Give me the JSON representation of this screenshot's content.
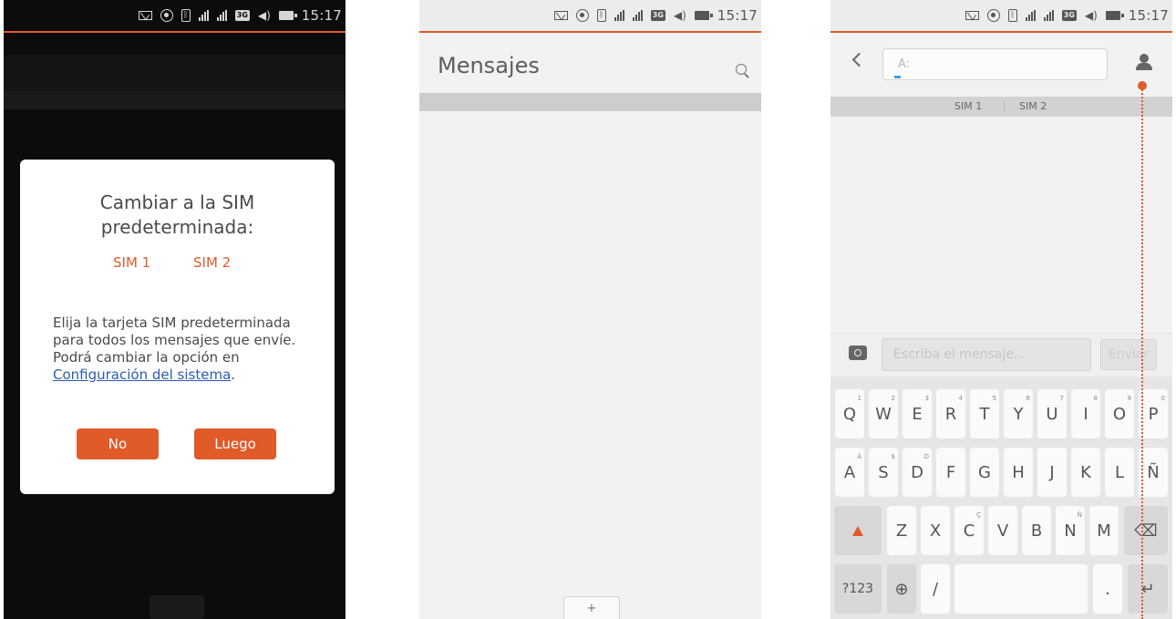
{
  "colors": {
    "accent": "#e05a2a",
    "link": "#2c5bb3",
    "dark_bg": "#0c0c0c",
    "light_bg": "#f2f2f2"
  },
  "status_bar": {
    "time": "15:17",
    "icons": [
      "envelope-icon",
      "location-icon",
      "bluetooth-icon",
      "signal-icon",
      "signal-icon",
      "3g-icon",
      "volume-icon",
      "battery-charging-icon"
    ],
    "network_label": "3G"
  },
  "screen1": {
    "dialog": {
      "title": "Cambiar a la SIM\npredeterminada:",
      "sim1": "SIM 1",
      "sim2": "SIM 2",
      "body_before_link": "Elija la tarjeta SIM predeterminada para todos los mensajes que envíe. Podrá cambiar la opción en ",
      "link": "Configuración del sistema",
      "body_after_link": ".",
      "no_button": "No",
      "later_button": "Luego"
    }
  },
  "screen2": {
    "title": "Mensajes",
    "search_icon": "search-icon",
    "new_button": "+"
  },
  "screen3": {
    "to_placeholder": "A:",
    "sim1": "SIM 1",
    "sim2": "SIM 2",
    "message_placeholder": "Escriba el mensaje...",
    "send_button": "Enviar",
    "keyboard": {
      "row1": [
        [
          "Q",
          "1"
        ],
        [
          "W",
          "2"
        ],
        [
          "E",
          "3"
        ],
        [
          "R",
          "4"
        ],
        [
          "T",
          "5"
        ],
        [
          "Y",
          "6"
        ],
        [
          "U",
          "7"
        ],
        [
          "I",
          "8"
        ],
        [
          "O",
          "9"
        ],
        [
          "P",
          "0"
        ]
      ],
      "row2": [
        [
          "A",
          "À"
        ],
        [
          "S",
          "$"
        ],
        [
          "D",
          "D"
        ],
        [
          "F",
          ""
        ],
        [
          "G",
          ""
        ],
        [
          "H",
          ""
        ],
        [
          "J",
          ""
        ],
        [
          "K",
          ""
        ],
        [
          "L",
          ""
        ],
        [
          "Ñ",
          ""
        ]
      ],
      "row3": [
        [
          "Z",
          ""
        ],
        [
          "X",
          ""
        ],
        [
          "C",
          "Ç"
        ],
        [
          "V",
          ""
        ],
        [
          "B",
          ""
        ],
        [
          "N",
          "Ñ"
        ],
        [
          "M",
          ""
        ]
      ],
      "symbols_key": "?123",
      "slash_key": "/",
      "period_key": "."
    }
  }
}
